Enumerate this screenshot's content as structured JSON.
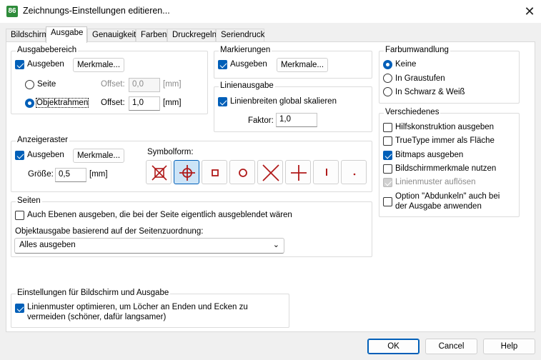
{
  "window": {
    "title": "Zeichnungs-Einstellungen editieren...",
    "app_icon_text": "86"
  },
  "tabs": [
    "Bildschirm",
    "Ausgabe",
    "Genauigkeit",
    "Farben",
    "Druckregeln",
    "Seriendruck"
  ],
  "active_tab": "Ausgabe",
  "ausgabebereich": {
    "label": "Ausgabebereich",
    "ausgeben_label": "Ausgeben",
    "ausgeben_checked": true,
    "merkmale_label": "Merkmale...",
    "seite_label": "Seite",
    "seite_selected": false,
    "objektrahmen_label": "Objektrahmen",
    "objektrahmen_selected": true,
    "offset1_label": "Offset:",
    "offset1_value": "0,0",
    "offset1_unit": "[mm]",
    "offset2_label": "Offset:",
    "offset2_value": "1,0",
    "offset2_unit": "[mm]"
  },
  "markierungen": {
    "label": "Markierungen",
    "ausgeben_label": "Ausgeben",
    "ausgeben_checked": true,
    "merkmale_label": "Merkmale..."
  },
  "linienausgabe": {
    "label": "Linienausgabe",
    "skalieren_label": "Linienbreiten global skalieren",
    "skalieren_checked": true,
    "faktor_label": "Faktor:",
    "faktor_value": "1,0"
  },
  "farbumwandlung": {
    "label": "Farbumwandlung",
    "options": [
      "Keine",
      "In Graustufen",
      "In Schwarz & Weiß"
    ],
    "selected": "Keine"
  },
  "verschiedenes": {
    "label": "Verschiedenes",
    "items": [
      {
        "label": "Hilfskonstruktion ausgeben",
        "checked": false,
        "disabled": false
      },
      {
        "label": "TrueType immer als Fläche",
        "checked": false,
        "disabled": false
      },
      {
        "label": "Bitmaps ausgeben",
        "checked": true,
        "disabled": false
      },
      {
        "label": "Bildschirmmerkmale nutzen",
        "checked": false,
        "disabled": false
      },
      {
        "label": "Linienmuster auflösen",
        "checked": true,
        "disabled": true
      },
      {
        "label": "Option \"Abdunkeln\" auch bei",
        "label2": "der Ausgabe anwenden",
        "checked": false,
        "disabled": false
      }
    ]
  },
  "anzeigeraster": {
    "label": "Anzeigeraster",
    "ausgeben_label": "Ausgeben",
    "ausgeben_checked": true,
    "merkmale_label": "Merkmale...",
    "groesse_label": "Größe:",
    "groesse_value": "0,5",
    "groesse_unit": "[mm]",
    "symbolform_label": "Symbolform:",
    "symbols": [
      "square-x-symbol",
      "crosshair-circle-symbol",
      "square-symbol",
      "circle-symbol",
      "x-symbol",
      "plus-symbol",
      "vertical-line-symbol",
      "dot-symbol"
    ],
    "selected_symbol": "crosshair-circle-symbol",
    "symbol_color": "#b01a1a"
  },
  "seiten": {
    "label": "Seiten",
    "ebenen_label": "Auch Ebenen ausgeben, die bei der Seite eigentlich ausgeblendet wären",
    "ebenen_checked": false,
    "objektausgabe_label": "Objektausgabe basierend auf der Seitenzuordnung:",
    "objektausgabe_value": "Alles ausgeben"
  },
  "einstellungen": {
    "label": "Einstellungen für Bildschirm und Ausgabe",
    "linienmuster_label1": "Linienmuster optimieren, um Löcher an Enden und Ecken zu",
    "linienmuster_label2": "vermeiden (schöner, dafür langsamer)",
    "linienmuster_checked": true
  },
  "buttons": {
    "ok": "OK",
    "cancel": "Cancel",
    "help": "Help"
  },
  "colors": {
    "accent": "#005fb8",
    "selected_symbol_bg": "#cce4f7"
  }
}
